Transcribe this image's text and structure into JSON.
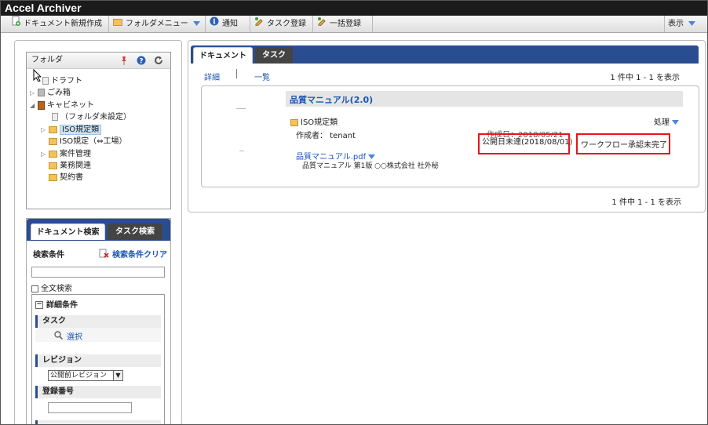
{
  "app_title": "Accel Archiver",
  "toolbar": {
    "new_doc": "ドキュメント新規作成",
    "folder_menu": "フォルダメニュー",
    "notify": "通知",
    "task_register": "タスク登録",
    "bulk_register": "一括登録",
    "view": "表示"
  },
  "folder_panel": {
    "title": "フォルダ",
    "items": [
      {
        "label": "ドラフト"
      },
      {
        "label": "ごみ箱"
      },
      {
        "label": "キャビネット"
      },
      {
        "label": "（フォルダ未設定）"
      },
      {
        "label": "ISO規定類"
      },
      {
        "label": "ISO規定（⇔工場）"
      },
      {
        "label": "案件管理"
      },
      {
        "label": "業務関連"
      },
      {
        "label": "契約書"
      }
    ]
  },
  "search_panel": {
    "tab_doc": "ドキュメント検索",
    "tab_task": "タスク検索",
    "conditions_label": "検索条件",
    "clear_link": "検索条件クリア",
    "fulltext_label": "全文検索",
    "detail_label": "詳細条件",
    "task_label": "タスク",
    "select_link": "選択",
    "revision_label": "レビジョン",
    "revision_value": "公開前レビジョン",
    "regno_label": "登録番号"
  },
  "main": {
    "tab_document": "ドキュメント",
    "tab_task": "タスク",
    "view_detail": "詳細",
    "view_list": "一覧",
    "count_top": "1 件中 1 - 1 を表示",
    "count_bottom": "1 件中 1 - 1 を表示",
    "doc_title": "品質マニュアル(2.0)",
    "folder_name": "ISO規定類",
    "action_label": "処理",
    "author": "作成者： tenant",
    "created": "作成日：2018/05/21",
    "publish_status": "公開日未達(2018/08/01)",
    "workflow_status": "ワークフロー承認未完了",
    "file_name": "品質マニュアル.pdf",
    "file_desc": "品質マニュアル 第1版 ○○株式会社 社外秘"
  },
  "colors": {
    "accent": "#2a4d92",
    "highlight": "#e8141b",
    "link": "#1a55b5"
  }
}
